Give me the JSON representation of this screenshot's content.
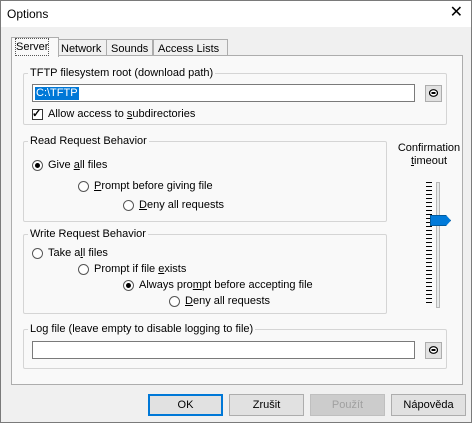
{
  "window": {
    "title": "Options",
    "close_glyph": "✕"
  },
  "tabs": [
    {
      "label": "Server",
      "active": true
    },
    {
      "label": "Network",
      "active": false
    },
    {
      "label": "Sounds",
      "active": false
    },
    {
      "label": "Access Lists",
      "active": false
    }
  ],
  "fs_root": {
    "legend": "TFTP filesystem root (download path)",
    "value": "C:\\TFTP",
    "allow_subdirs_pre": "Allow access to ",
    "allow_subdirs_key": "s",
    "allow_subdirs_post": "ubdirectories",
    "allow_subdirs_checked": true,
    "browse_icon": "folder-icon"
  },
  "read_behavior": {
    "legend": "Read Request Behavior",
    "opt1_pre": "Give ",
    "opt1_key": "a",
    "opt1_post": "ll files",
    "opt2_pre": "",
    "opt2_key": "P",
    "opt2_post": "rompt before giving file",
    "opt3_pre": "",
    "opt3_key": "D",
    "opt3_post": "eny all requests",
    "selected": 1
  },
  "write_behavior": {
    "legend": "Write Request Behavior",
    "opt1_pre": "Take a",
    "opt1_key": "l",
    "opt1_post": "l files",
    "opt2_pre": "Prompt if file ",
    "opt2_key": "e",
    "opt2_post": "xists",
    "opt3_pre": "Always pro",
    "opt3_key": "m",
    "opt3_post": "pt before accepting file",
    "opt4_pre": "",
    "opt4_key": "D",
    "opt4_post": "eny all requests",
    "selected": 3
  },
  "confirmation": {
    "line1": "Confirmation",
    "line2_key": "t",
    "line2_post": "imeout",
    "level": 0.28
  },
  "log_file": {
    "legend": "Log file (leave empty to disable logging to file)",
    "value": ""
  },
  "buttons": {
    "ok": "OK",
    "cancel": "Zrušit",
    "apply": "Použít",
    "help": "Nápověda"
  }
}
